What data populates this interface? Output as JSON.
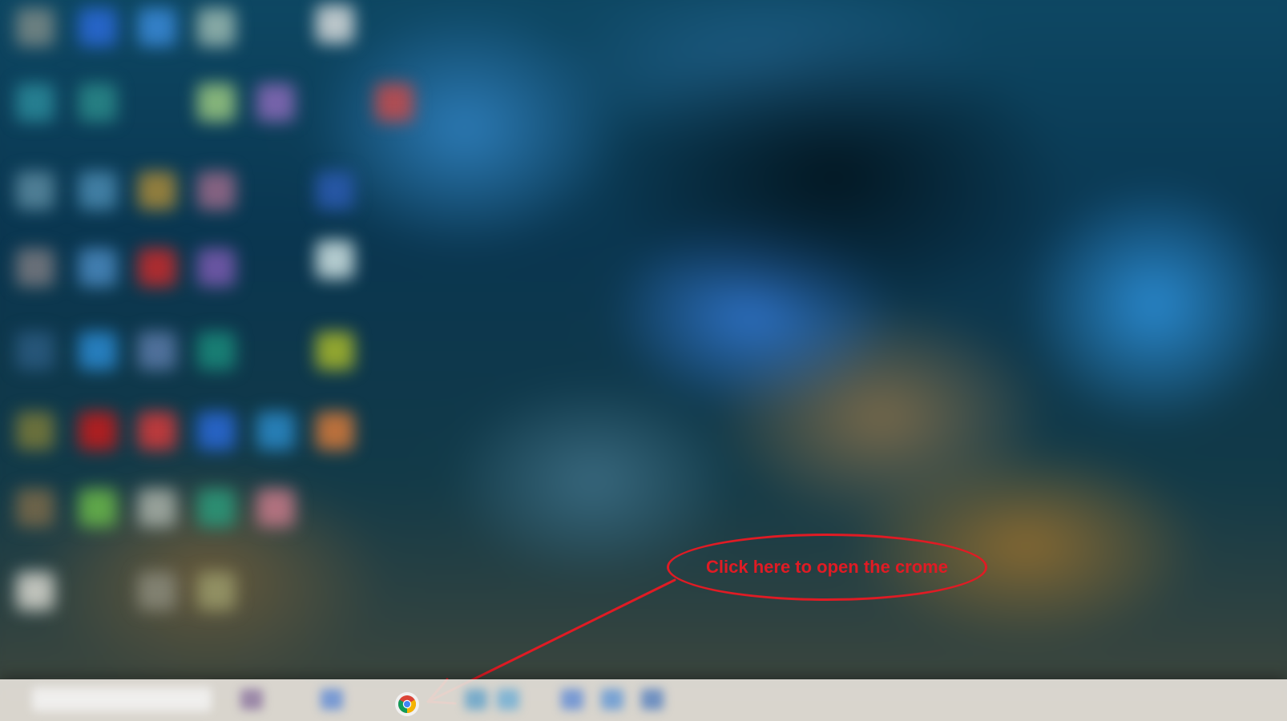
{
  "annotation": {
    "text": "Click here to open the crome",
    "color": "#e01b24"
  },
  "taskbar": {
    "pinned_app": "chrome-icon"
  },
  "colors": {
    "annotation": "#e01b24",
    "taskbar": "#e6e2da"
  }
}
